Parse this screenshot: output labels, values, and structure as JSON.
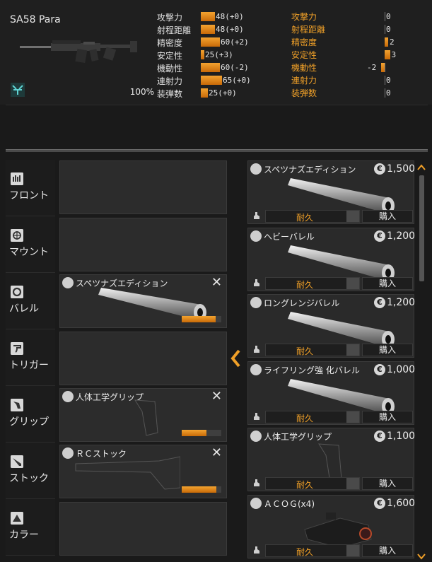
{
  "weapon": {
    "name": "SA58 Para",
    "ammo_percent": "100%"
  },
  "stats": [
    {
      "label": "攻撃力",
      "value": "48(+0)",
      "bar": 20
    },
    {
      "label": "射程距離",
      "value": "48(+0)",
      "bar": 20
    },
    {
      "label": "精密度",
      "value": "60(+2)",
      "bar": 27
    },
    {
      "label": "安定性",
      "value": "25(+3)",
      "bar": 5
    },
    {
      "label": "機動性",
      "value": "60(-2)",
      "bar": 27
    },
    {
      "label": "連射力",
      "value": "65(+0)",
      "bar": 30
    },
    {
      "label": "装弾数",
      "value": "25(+0)",
      "bar": 10
    }
  ],
  "stat_changes": [
    {
      "label": "攻撃力",
      "value": "0",
      "delta": 0
    },
    {
      "label": "射程距離",
      "value": "0",
      "delta": 0
    },
    {
      "label": "精密度",
      "value": "2",
      "delta": 2
    },
    {
      "label": "安定性",
      "value": "3",
      "delta": 3
    },
    {
      "label": "機動性",
      "value": "-2",
      "delta": -2
    },
    {
      "label": "連射力",
      "value": "0",
      "delta": 0
    },
    {
      "label": "装弾数",
      "value": "0",
      "delta": 0
    }
  ],
  "categories": [
    {
      "label": "フロント"
    },
    {
      "label": "マウント"
    },
    {
      "label": "バレル"
    },
    {
      "label": "トリガー"
    },
    {
      "label": "グリップ"
    },
    {
      "label": "ストック"
    },
    {
      "label": "カラー"
    }
  ],
  "equipped": {
    "barrel": {
      "name": "スペツナズエディション",
      "durability": 0.85
    },
    "grip": {
      "name": "人体工学グリップ",
      "durability": 0.62
    },
    "stock": {
      "name": "ＲＣストック",
      "durability": 0.88
    }
  },
  "shop": {
    "durability_label": "耐久",
    "buy_label": "購入",
    "items": [
      {
        "name": "スペツナズエディション",
        "price": "1,500",
        "img": "barrel"
      },
      {
        "name": "ヘビーバレル",
        "price": "1,200",
        "img": "barrel"
      },
      {
        "name": "ロングレンジバレル",
        "price": "1,200",
        "img": "barrel"
      },
      {
        "name": "ライフリング強 化バレル",
        "price": "1,000",
        "img": "barrel"
      },
      {
        "name": "人体工学グリップ",
        "price": "1,100",
        "img": "grip"
      },
      {
        "name": "ＡＣＯＧ(x4)",
        "price": "1,600",
        "img": "scope"
      }
    ]
  },
  "colors": {
    "accent": "#f0a028",
    "bar": "#e88a18"
  }
}
